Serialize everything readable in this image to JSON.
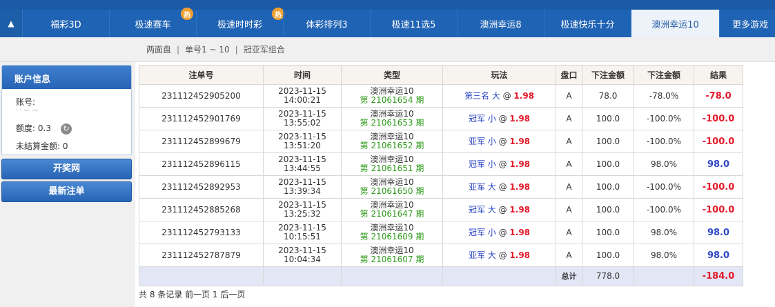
{
  "nav": {
    "tabs": [
      {
        "label": "福彩3D",
        "hot": false,
        "active": false
      },
      {
        "label": "极速赛车",
        "hot": true,
        "active": false
      },
      {
        "label": "极速时时彩",
        "hot": true,
        "active": false
      },
      {
        "label": "体彩排列3",
        "hot": false,
        "active": false
      },
      {
        "label": "极速11选5",
        "hot": false,
        "active": false
      },
      {
        "label": "澳洲幸运8",
        "hot": false,
        "active": false
      },
      {
        "label": "极速快乐十分",
        "hot": false,
        "active": false
      },
      {
        "label": "澳洲幸运10",
        "hot": false,
        "active": true
      },
      {
        "label": "更多游戏",
        "hot": false,
        "active": false
      }
    ],
    "hot_badge": "热"
  },
  "subnav": {
    "items": [
      "两面盘",
      "单号1 ~ 10",
      "冠亚军组合"
    ]
  },
  "sidebar": {
    "account_title": "账户信息",
    "account_label": "账号:",
    "account_value": "· · — —",
    "credit_label": "额度:",
    "credit_value": "0.3",
    "unsettled_label": "未结算金额:",
    "unsettled_value": "0",
    "btn_results": "开奖网",
    "btn_latest": "最新注单"
  },
  "table": {
    "headers": [
      "注单号",
      "时间",
      "类型",
      "玩法",
      "盘口",
      "下注金额",
      "下注金额",
      "结果"
    ],
    "rows": [
      {
        "id": "231112452905200",
        "date": "2023-11-15",
        "time": "14:00:21",
        "game": "澳洲幸运10",
        "issue": "第 21061654 期",
        "play": "第三名 大",
        "odds": "1.98",
        "pan": "A",
        "amount": "78.0",
        "pct": "-78.0%",
        "result": "-78.0",
        "positive": false
      },
      {
        "id": "231112452901769",
        "date": "2023-11-15",
        "time": "13:55:02",
        "game": "澳洲幸运10",
        "issue": "第 21061653 期",
        "play": "冠军 小",
        "odds": "1.98",
        "pan": "A",
        "amount": "100.0",
        "pct": "-100.0%",
        "result": "-100.0",
        "positive": false
      },
      {
        "id": "231112452899679",
        "date": "2023-11-15",
        "time": "13:51:20",
        "game": "澳洲幸运10",
        "issue": "第 21061652 期",
        "play": "亚军 小",
        "odds": "1.98",
        "pan": "A",
        "amount": "100.0",
        "pct": "-100.0%",
        "result": "-100.0",
        "positive": false
      },
      {
        "id": "231112452896115",
        "date": "2023-11-15",
        "time": "13:44:55",
        "game": "澳洲幸运10",
        "issue": "第 21061651 期",
        "play": "冠军 小",
        "odds": "1.98",
        "pan": "A",
        "amount": "100.0",
        "pct": "98.0%",
        "result": "98.0",
        "positive": true
      },
      {
        "id": "231112452892953",
        "date": "2023-11-15",
        "time": "13:39:34",
        "game": "澳洲幸运10",
        "issue": "第 21061650 期",
        "play": "亚军 大",
        "odds": "1.98",
        "pan": "A",
        "amount": "100.0",
        "pct": "-100.0%",
        "result": "-100.0",
        "positive": false
      },
      {
        "id": "231112452885268",
        "date": "2023-11-15",
        "time": "13:25:32",
        "game": "澳洲幸运10",
        "issue": "第 21061647 期",
        "play": "冠军 大",
        "odds": "1.98",
        "pan": "A",
        "amount": "100.0",
        "pct": "-100.0%",
        "result": "-100.0",
        "positive": false
      },
      {
        "id": "231112452793133",
        "date": "2023-11-15",
        "time": "10:15:51",
        "game": "澳洲幸运10",
        "issue": "第 21061609 期",
        "play": "冠军 小",
        "odds": "1.98",
        "pan": "A",
        "amount": "100.0",
        "pct": "98.0%",
        "result": "98.0",
        "positive": true
      },
      {
        "id": "231112452787879",
        "date": "2023-11-15",
        "time": "10:04:34",
        "game": "澳洲幸运10",
        "issue": "第 21061607 期",
        "play": "亚军 大",
        "odds": "1.98",
        "pan": "A",
        "amount": "100.0",
        "pct": "98.0%",
        "result": "98.0",
        "positive": true
      }
    ],
    "total_label": "总计",
    "total_amount": "778.0",
    "total_result": "-184.0"
  },
  "pager": {
    "text": "共 8 条记录 前一页 1 后一页"
  },
  "colors": {
    "nav_bg": "#1f63b4",
    "negative": "#e4192a",
    "positive": "#2b45c5",
    "issue_green": "#2e9b1a"
  }
}
